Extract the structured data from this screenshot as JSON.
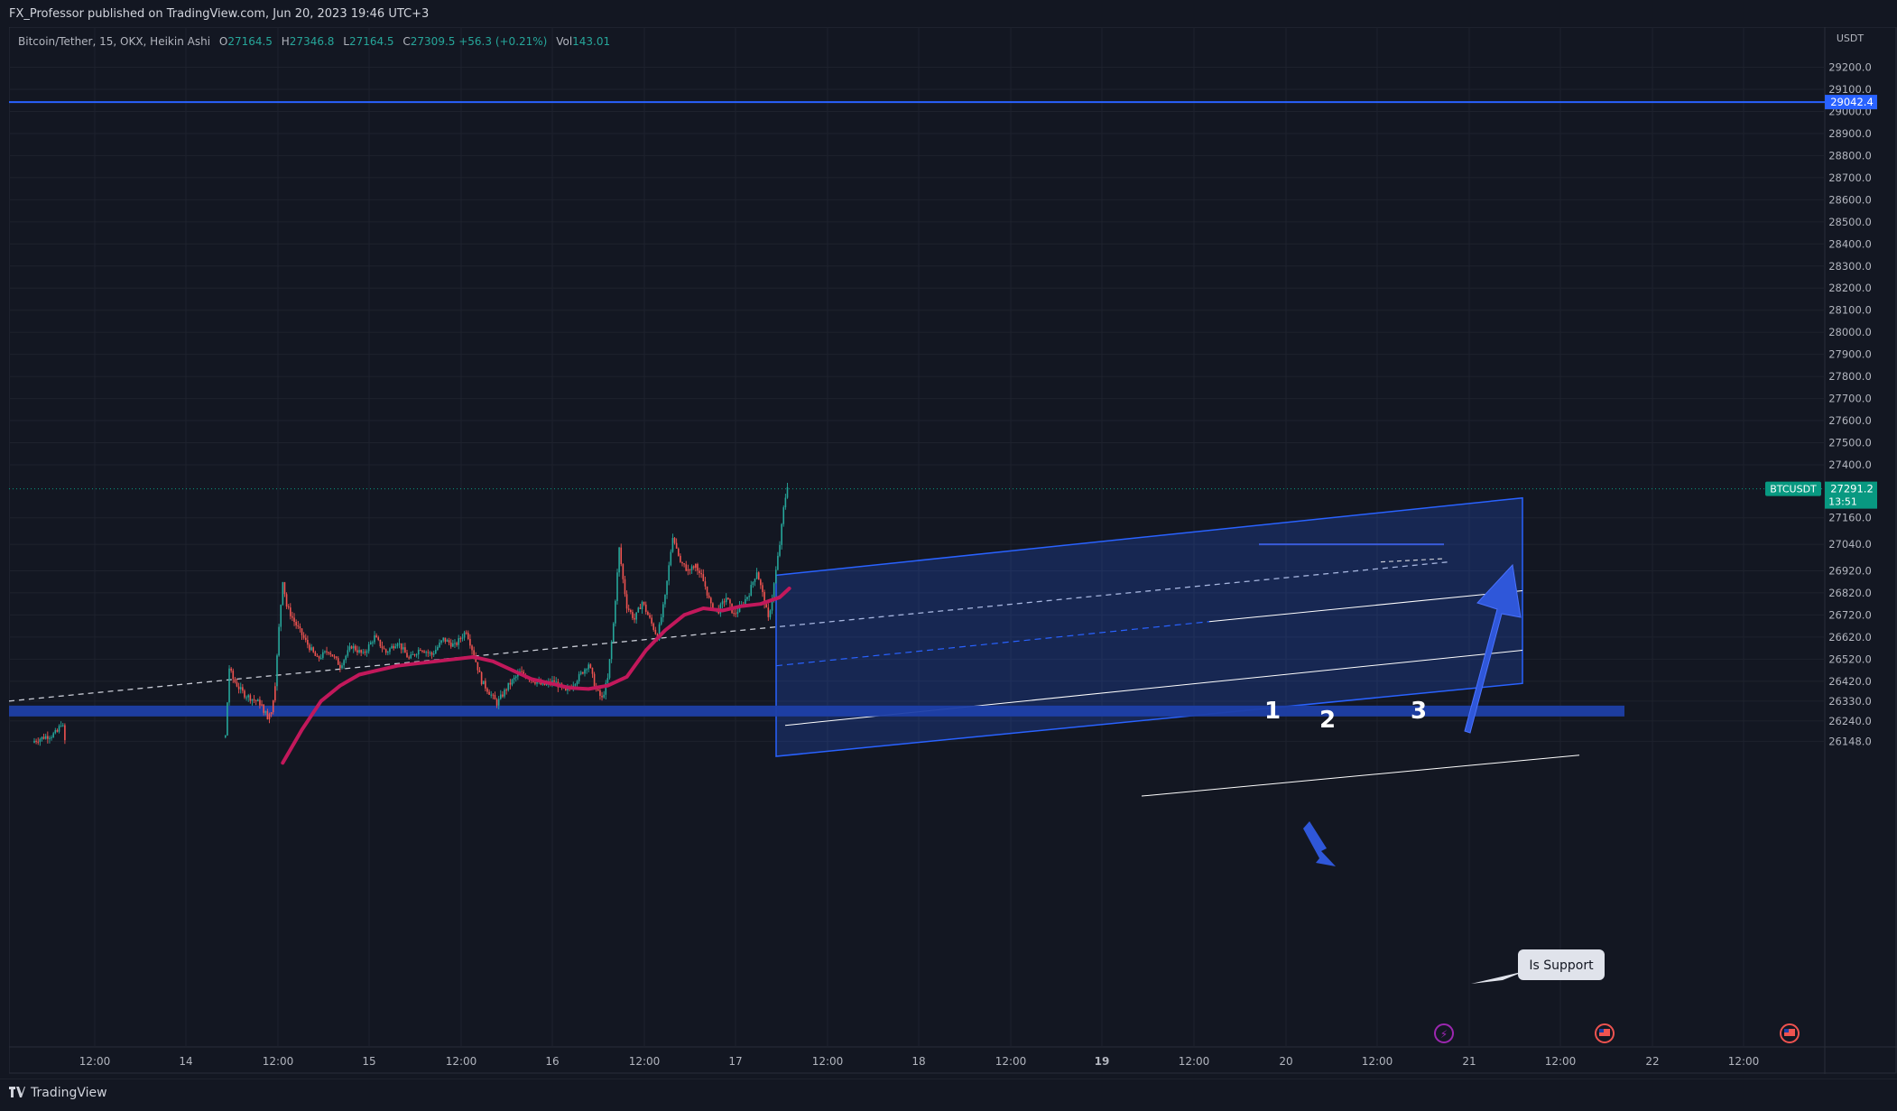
{
  "header": {
    "published": "FX_Professor published on TradingView.com, Jun 20, 2023 19:46 UTC+3"
  },
  "legend": {
    "symbol": "Bitcoin/Tether, 15, OKX, Heikin Ashi",
    "o_label": "O",
    "o": "27164.5",
    "h_label": "H",
    "h": "27346.8",
    "l_label": "L",
    "l": "27164.5",
    "c_label": "C",
    "c": "27309.5",
    "change": "+56.3 (+0.21%)",
    "vol_label": "Vol",
    "vol": "143.01"
  },
  "footer": {
    "brand": "TradingView",
    "logo_icon": "tradingview-logo-icon"
  },
  "chart_data": {
    "type": "candlestick",
    "title": "Bitcoin/Tether, 15, OKX, Heikin Ashi",
    "currency": "USDT",
    "price_axis": {
      "ylim": [
        26100,
        29300
      ],
      "ticks": [
        "29200.0",
        "29100.0",
        "29000.0",
        "28900.0",
        "28800.0",
        "28700.0",
        "28600.0",
        "28500.0",
        "28400.0",
        "28300.0",
        "28200.0",
        "28100.0",
        "28000.0",
        "27900.0",
        "27800.0",
        "27700.0",
        "27600.0",
        "27500.0",
        "27400.0",
        "27160.0",
        "27040.0",
        "26920.0",
        "26820.0",
        "26720.0",
        "26620.0",
        "26520.0",
        "26420.0",
        "26330.0",
        "26240.0",
        "26148.0"
      ]
    },
    "time_axis": {
      "ticks": [
        "12:00",
        "14",
        "12:00",
        "15",
        "12:00",
        "16",
        "12:00",
        "17",
        "12:00",
        "18",
        "12:00",
        "19",
        "12:00",
        "20",
        "12:00",
        "21",
        "12:00",
        "22",
        "12:00"
      ],
      "bold_ticks": [
        "19"
      ]
    },
    "last_price": {
      "symbol": "BTCUSDT",
      "price": "27291.2",
      "countdown": "13:51",
      "value": 27291.2
    },
    "horizontal_line": {
      "label": "29042.4",
      "value": 29042.4
    },
    "support_zone": {
      "value": 26285
    },
    "annotations": {
      "peak_1": "1",
      "peak_2": "2",
      "peak_3": "3",
      "callout": "Is Support"
    },
    "colors": {
      "up": "#26a69a",
      "down": "#ef5350",
      "ma": "#c2185b",
      "channel": "#2962ff",
      "support": "#1e3fa8",
      "arrow": "#2f57d9",
      "last_price": "#089981"
    },
    "series": [
      {
        "name": "",
        "type": "candlestick",
        "anchors_close": [
          [
            0,
            26150
          ],
          [
            3,
            26160
          ],
          [
            6,
            26170
          ],
          [
            9,
            26175
          ],
          [
            12,
            26190
          ],
          [
            14,
            26230
          ],
          [
            15,
            26210
          ],
          [
            16,
            26150
          ],
          [
            100,
            26170
          ],
          [
            102,
            26480
          ],
          [
            104,
            26430
          ],
          [
            107,
            26390
          ],
          [
            110,
            26360
          ],
          [
            114,
            26340
          ],
          [
            118,
            26320
          ],
          [
            122,
            26260
          ],
          [
            124,
            26290
          ],
          [
            126,
            26400
          ],
          [
            128,
            26660
          ],
          [
            130,
            26880
          ],
          [
            132,
            26760
          ],
          [
            136,
            26690
          ],
          [
            142,
            26600
          ],
          [
            148,
            26520
          ],
          [
            154,
            26560
          ],
          [
            160,
            26490
          ],
          [
            166,
            26580
          ],
          [
            172,
            26540
          ],
          [
            178,
            26620
          ],
          [
            184,
            26550
          ],
          [
            190,
            26600
          ],
          [
            196,
            26520
          ],
          [
            202,
            26570
          ],
          [
            208,
            26540
          ],
          [
            214,
            26610
          ],
          [
            220,
            26580
          ],
          [
            226,
            26650
          ],
          [
            230,
            26540
          ],
          [
            234,
            26420
          ],
          [
            238,
            26370
          ],
          [
            242,
            26320
          ],
          [
            248,
            26400
          ],
          [
            254,
            26460
          ],
          [
            260,
            26430
          ],
          [
            266,
            26400
          ],
          [
            272,
            26420
          ],
          [
            278,
            26370
          ],
          [
            284,
            26430
          ],
          [
            290,
            26500
          ],
          [
            294,
            26380
          ],
          [
            297,
            26340
          ],
          [
            300,
            26430
          ],
          [
            303,
            26680
          ],
          [
            306,
            27020
          ],
          [
            308,
            26880
          ],
          [
            310,
            26760
          ],
          [
            314,
            26700
          ],
          [
            318,
            26780
          ],
          [
            322,
            26700
          ],
          [
            326,
            26620
          ],
          [
            330,
            26800
          ],
          [
            334,
            27080
          ],
          [
            338,
            26960
          ],
          [
            342,
            26920
          ],
          [
            346,
            26940
          ],
          [
            350,
            26880
          ],
          [
            354,
            26760
          ],
          [
            358,
            26740
          ],
          [
            362,
            26800
          ],
          [
            366,
            26720
          ],
          [
            370,
            26760
          ],
          [
            374,
            26820
          ],
          [
            378,
            26920
          ],
          [
            382,
            26780
          ],
          [
            384,
            26700
          ],
          [
            386,
            26800
          ],
          [
            388,
            26920
          ],
          [
            390,
            27040
          ],
          [
            392,
            27200
          ],
          [
            394,
            27309
          ]
        ],
        "down_spans": [
          [
            118,
            126
          ],
          [
            336,
            350
          ]
        ]
      },
      {
        "name": "",
        "type": "ma",
        "x": [
          130,
          140,
          150,
          160,
          170,
          180,
          190,
          200,
          210,
          220,
          230,
          240,
          250,
          260,
          270,
          280,
          290,
          300,
          310,
          320,
          330,
          340,
          350,
          360,
          370,
          380,
          390,
          395
        ],
        "values": [
          26050,
          26200,
          26330,
          26400,
          26450,
          26470,
          26490,
          26500,
          26510,
          26520,
          26530,
          26510,
          26470,
          26430,
          26410,
          26390,
          26385,
          26400,
          26440,
          26560,
          26650,
          26720,
          26750,
          26740,
          26760,
          26770,
          26800,
          26840
        ]
      }
    ]
  }
}
